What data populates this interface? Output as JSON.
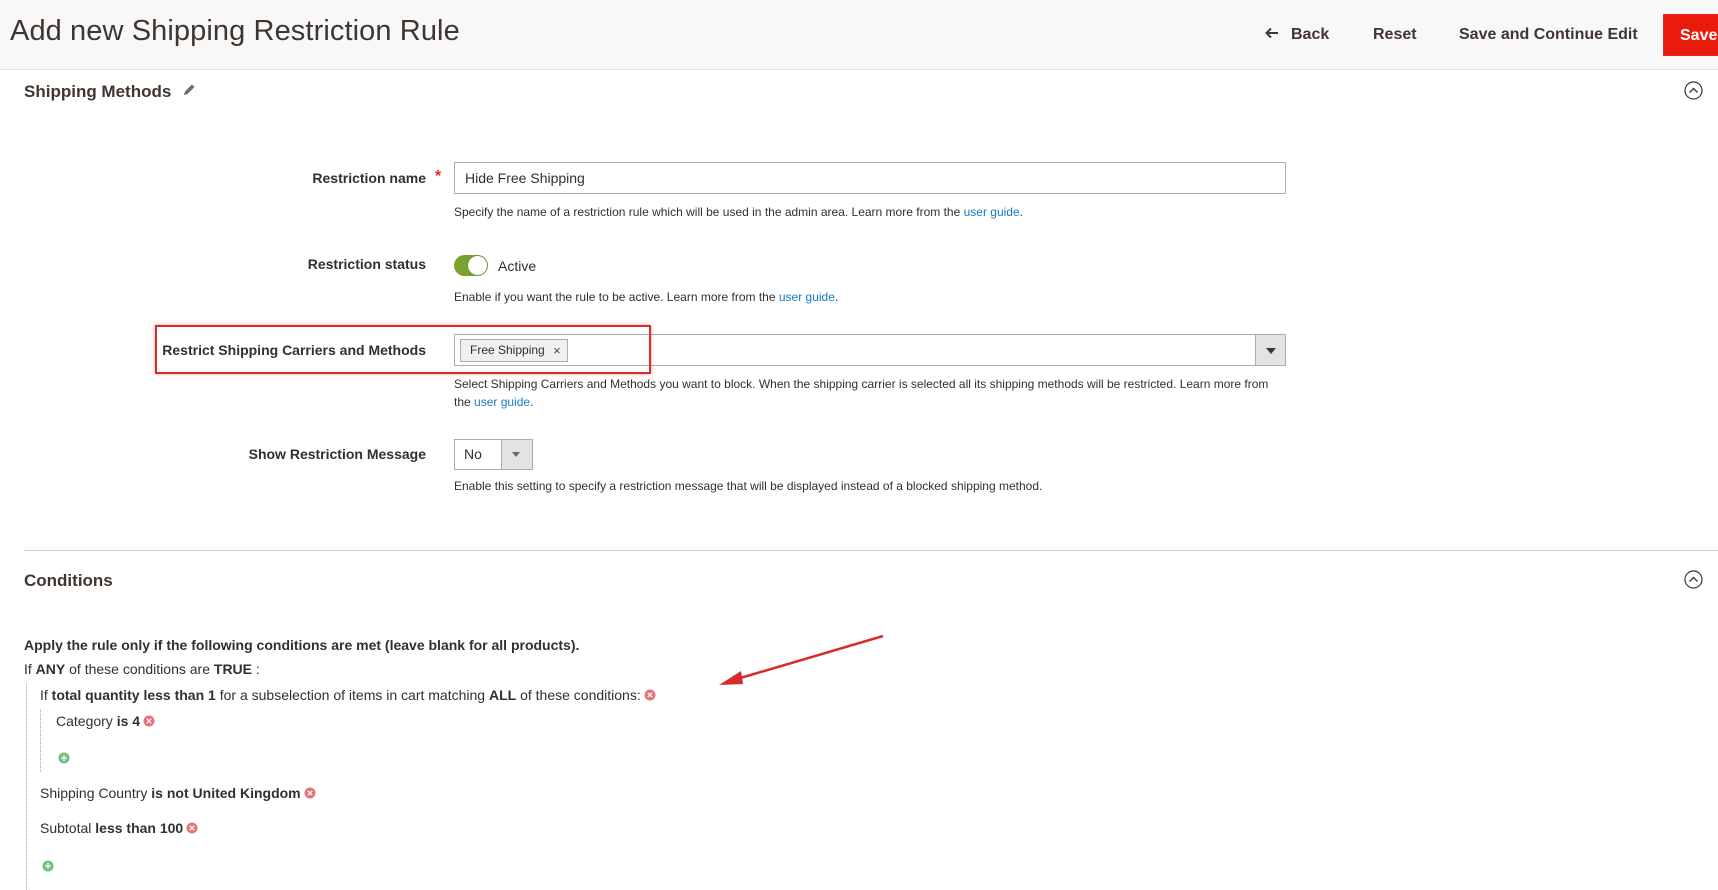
{
  "header": {
    "title": "Add new Shipping Restriction Rule",
    "back_label": "Back",
    "reset_label": "Reset",
    "save_continue_label": "Save and Continue Edit",
    "save_label": "Save"
  },
  "shipping_methods": {
    "title": "Shipping Methods",
    "restriction_name": {
      "label": "Restriction name",
      "required_mark": "*",
      "value": "Hide Free Shipping",
      "note": "Specify the name of a restriction rule which will be used in the admin area. Learn more from the ",
      "link": "user guide",
      "note_end": "."
    },
    "restriction_status": {
      "label": "Restriction status",
      "value_label": "Active",
      "enabled": true,
      "note": "Enable if you want the rule to be active. Learn more from the ",
      "link": "user guide",
      "note_end": "."
    },
    "carriers": {
      "label": "Restrict Shipping Carriers and Methods",
      "selected": [
        "Free Shipping"
      ],
      "remove_glyph": "×",
      "note": "Select Shipping Carriers and Methods you want to block. When the shipping carrier is selected all its shipping methods will be restricted. Learn more from the ",
      "link": "user guide",
      "note_end": "."
    },
    "restriction_message": {
      "label": "Show Restriction Message",
      "value": "No",
      "note": "Enable this setting to specify a restriction message that will be displayed instead of a blocked shipping method."
    }
  },
  "conditions": {
    "title": "Conditions",
    "heading": "Apply the rule only if the following conditions are met (leave blank for all products).",
    "root": {
      "prefix": "If",
      "aggregator": "ANY",
      "middle": "of these conditions are",
      "value": "TRUE",
      "suffix": ":"
    },
    "subselect": {
      "prefix": "If",
      "attribute": "total quantity",
      "operator": "less than",
      "value": "1",
      "middle": "for a subselection of items in cart matching",
      "aggregator": "ALL",
      "suffix": "of these conditions:"
    },
    "category": {
      "attribute": "Category",
      "operator": "is",
      "value": "4"
    },
    "shipping_country": {
      "attribute": "Shipping Country",
      "operator": "is not",
      "value": "United Kingdom"
    },
    "subtotal": {
      "attribute": "Subtotal",
      "operator": "less than",
      "value": "100"
    }
  },
  "colors": {
    "accent_red": "#eb1a0b",
    "toggle_green": "#79a22e",
    "link_blue": "#1979c3",
    "highlight_red": "#d62c2c"
  },
  "icons": [
    "arrow-left-icon",
    "pencil-icon",
    "chevron-up-circle-icon",
    "remove-x-icon",
    "caret-down-icon",
    "remove-condition-icon",
    "add-condition-icon"
  ]
}
